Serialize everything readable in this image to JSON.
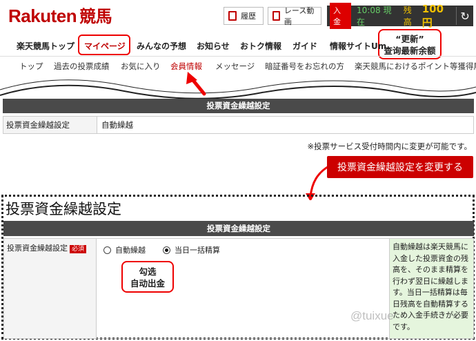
{
  "header": {
    "logo_text": "Rakuten",
    "logo_kanji": "競馬",
    "history_label": "履歴",
    "race_video_label": "レース動画",
    "deposit_label": "入金",
    "time_label": "10:08 現在",
    "balance_label": "残高",
    "balance_amount": "100 円",
    "refresh_icon": "↻"
  },
  "nav_main": {
    "items": [
      "楽天競馬トップ",
      "マイページ",
      "みんなの予想",
      "お知らせ",
      "おトク情報",
      "ガイド",
      "情報サイトUm"
    ],
    "active_index": 1
  },
  "nav_sub": {
    "items": [
      "トップ",
      "過去の投票成績",
      "お気に入り",
      "会員情報",
      "メッセージ",
      "暗証番号をお忘れの方",
      "楽天競馬におけるポイント等獲得履"
    ],
    "active_index": 3
  },
  "annotations": {
    "refresh_title": "“更新”",
    "refresh_desc": "查询最新余额",
    "check_title": "勾选",
    "check_desc": "自动出金"
  },
  "current_section": {
    "bar_title": "投票資金繰越設定",
    "label": "投票資金繰越設定",
    "value": "自動繰越"
  },
  "note": "※投票サービス受付時間内に変更が可能です。",
  "change_button": "投票資金繰越設定を変更する",
  "edit_section": {
    "title": "投票資金繰越設定",
    "bar_title": "投票資金繰越設定",
    "field_label": "投票資金繰越設定",
    "required": "必須",
    "options": [
      "自動繰越",
      "当日一括精算"
    ],
    "selected_index": 1,
    "help_text": "自動繰越は楽天競馬に入金した投票資金の残高を、そのまま精算を行わず翌日に繰越します。当日一括精算は毎日残高を自動精算するため入金手続きが必要です。"
  },
  "watermark": "@tuixue"
}
